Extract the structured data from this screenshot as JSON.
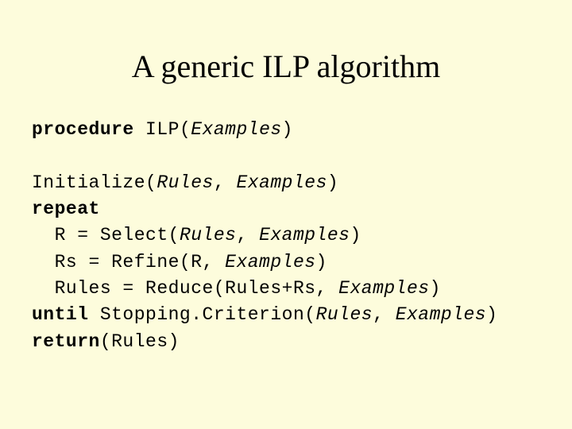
{
  "title": "A generic ILP algorithm",
  "kw": {
    "procedure": "procedure",
    "repeat": "repeat",
    "until": "until",
    "return": "return"
  },
  "it": {
    "Examples": "Examples",
    "Rules": "Rules"
  },
  "txt": {
    "ilp_open": " ILP(",
    "close": ")",
    "init_open": "Initialize(",
    "comma_sp": ", ",
    "r_eq_select": "  R = Select(",
    "rs_eq_refine": "  Rs = Refine(R, ",
    "rules_eq_reduce": "  Rules = Reduce(Rules+Rs, ",
    "stopping": " Stopping.Criterion(",
    "return_args": "(Rules)"
  }
}
